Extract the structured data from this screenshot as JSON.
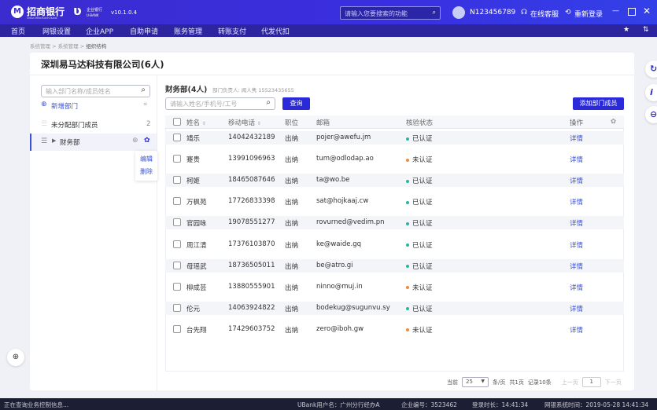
{
  "titlebar": {
    "bank_name": "招商银行",
    "bank_sub": "CHINA MERCHANTS BANK",
    "product": "企业银行",
    "product_sub": "U-BANK",
    "version": "v10.1.0.4",
    "search_placeholder": "请输入您要搜索的功能",
    "user": "N123456789",
    "service": "在线客服",
    "relogin": "重新登录"
  },
  "nav": [
    "首页",
    "网银设置",
    "企业APP",
    "自助申请",
    "账务管理",
    "转账支付",
    "代发代扣"
  ],
  "breadcrumb": [
    "系统管理",
    ">",
    "系统管理",
    ">",
    "组织结构"
  ],
  "company_title": "深圳易马达科技有限公司(6人)",
  "left": {
    "search_placeholder": "输入部门名称/成员姓名",
    "add_dept": "新增部门",
    "unassigned": "未分配部门成员",
    "unassigned_count": "2",
    "dept": "财务部",
    "menu": [
      "编辑",
      "删除"
    ]
  },
  "dept": {
    "title": "财务部(4人)",
    "manager": "部门负责人: 闻人隽 15523435655",
    "search_placeholder": "请输入姓名/手机号/工号",
    "query": "查询",
    "add_member": "添加部门成员"
  },
  "table": {
    "headers": [
      "姓名",
      "移动电话",
      "职位",
      "邮箱",
      "核验状态",
      "操作"
    ],
    "rows": [
      [
        "靖乐",
        "14042432189",
        "出纳",
        "pojer@awefu.jm",
        "已认证",
        "详情"
      ],
      [
        "蹇贵",
        "13991096963",
        "出纳",
        "tum@odlodap.ao",
        "未认证",
        "详情"
      ],
      [
        "柯姬",
        "18465087646",
        "出纳",
        "ta@wo.be",
        "已认证",
        "详情"
      ],
      [
        "万枫苑",
        "17726833398",
        "出纳",
        "sat@hojkaaj.cw",
        "已认证",
        "详情"
      ],
      [
        "官园咏",
        "19078551277",
        "出纳",
        "rovurned@vedim.pn",
        "已认证",
        "详情"
      ],
      [
        "周江清",
        "17376103870",
        "出纳",
        "ke@waide.gq",
        "已认证",
        "详情"
      ],
      [
        "母瑶武",
        "18736505011",
        "出纳",
        "be@atro.gi",
        "已认证",
        "详情"
      ],
      [
        "柳成芸",
        "13880555901",
        "出纳",
        "ninno@muj.in",
        "未认证",
        "详情"
      ],
      [
        "伦元",
        "14063924822",
        "出纳",
        "bodekug@sugunvu.sy",
        "已认证",
        "详情"
      ],
      [
        "台先翔",
        "17429603752",
        "出纳",
        "zero@iboh.gw",
        "未认证",
        "详情"
      ]
    ]
  },
  "colors": {
    "verified": "#2bb5a0",
    "unverified": "#f08a3c",
    "accent": "#2b2ad8"
  },
  "pagination": {
    "current": "当前",
    "page_size": "25",
    "per_page": "条/页",
    "total_pages": "共1页",
    "records": "记录10条",
    "prev": "上一页",
    "page": "1",
    "next": "下一页"
  },
  "statusbar": {
    "left": "正在查询业务控制信息...",
    "user": "UBank用户名：广州分行经办A",
    "corp": "企业编号：3523462",
    "login": "登录时长：14:41:34",
    "time": "网银系统时间：2019-05-28 14:41:34"
  }
}
